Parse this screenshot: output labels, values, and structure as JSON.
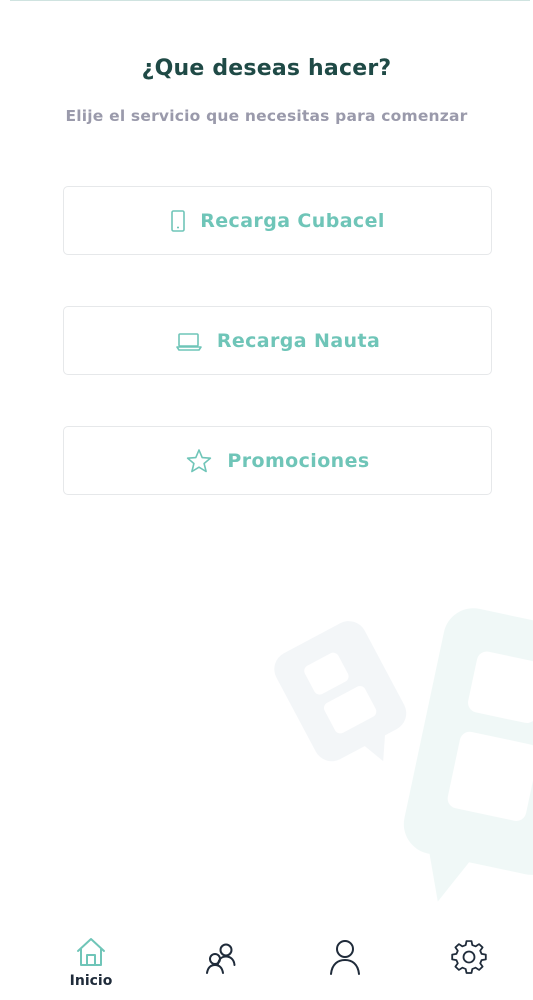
{
  "header": {
    "title": "¿Que deseas hacer?",
    "subtitle": "Elije el servicio que necesitas para comenzar"
  },
  "options": [
    {
      "label": "Recarga Cubacel",
      "icon": "phone-icon"
    },
    {
      "label": "Recarga Nauta",
      "icon": "laptop-icon"
    },
    {
      "label": "Promociones",
      "icon": "star-icon"
    }
  ],
  "bottom_nav": {
    "active": "inicio",
    "items": [
      {
        "label": "Inicio",
        "icon": "home-icon"
      },
      {
        "label": "",
        "icon": "users-icon"
      },
      {
        "label": "",
        "icon": "profile-icon"
      },
      {
        "label": "",
        "icon": "settings-icon"
      }
    ]
  },
  "colors": {
    "accent": "#6fc5b8",
    "title": "#1f4a46",
    "subtitle": "#9a9aab",
    "nav_icon": "#1f2b3a"
  }
}
